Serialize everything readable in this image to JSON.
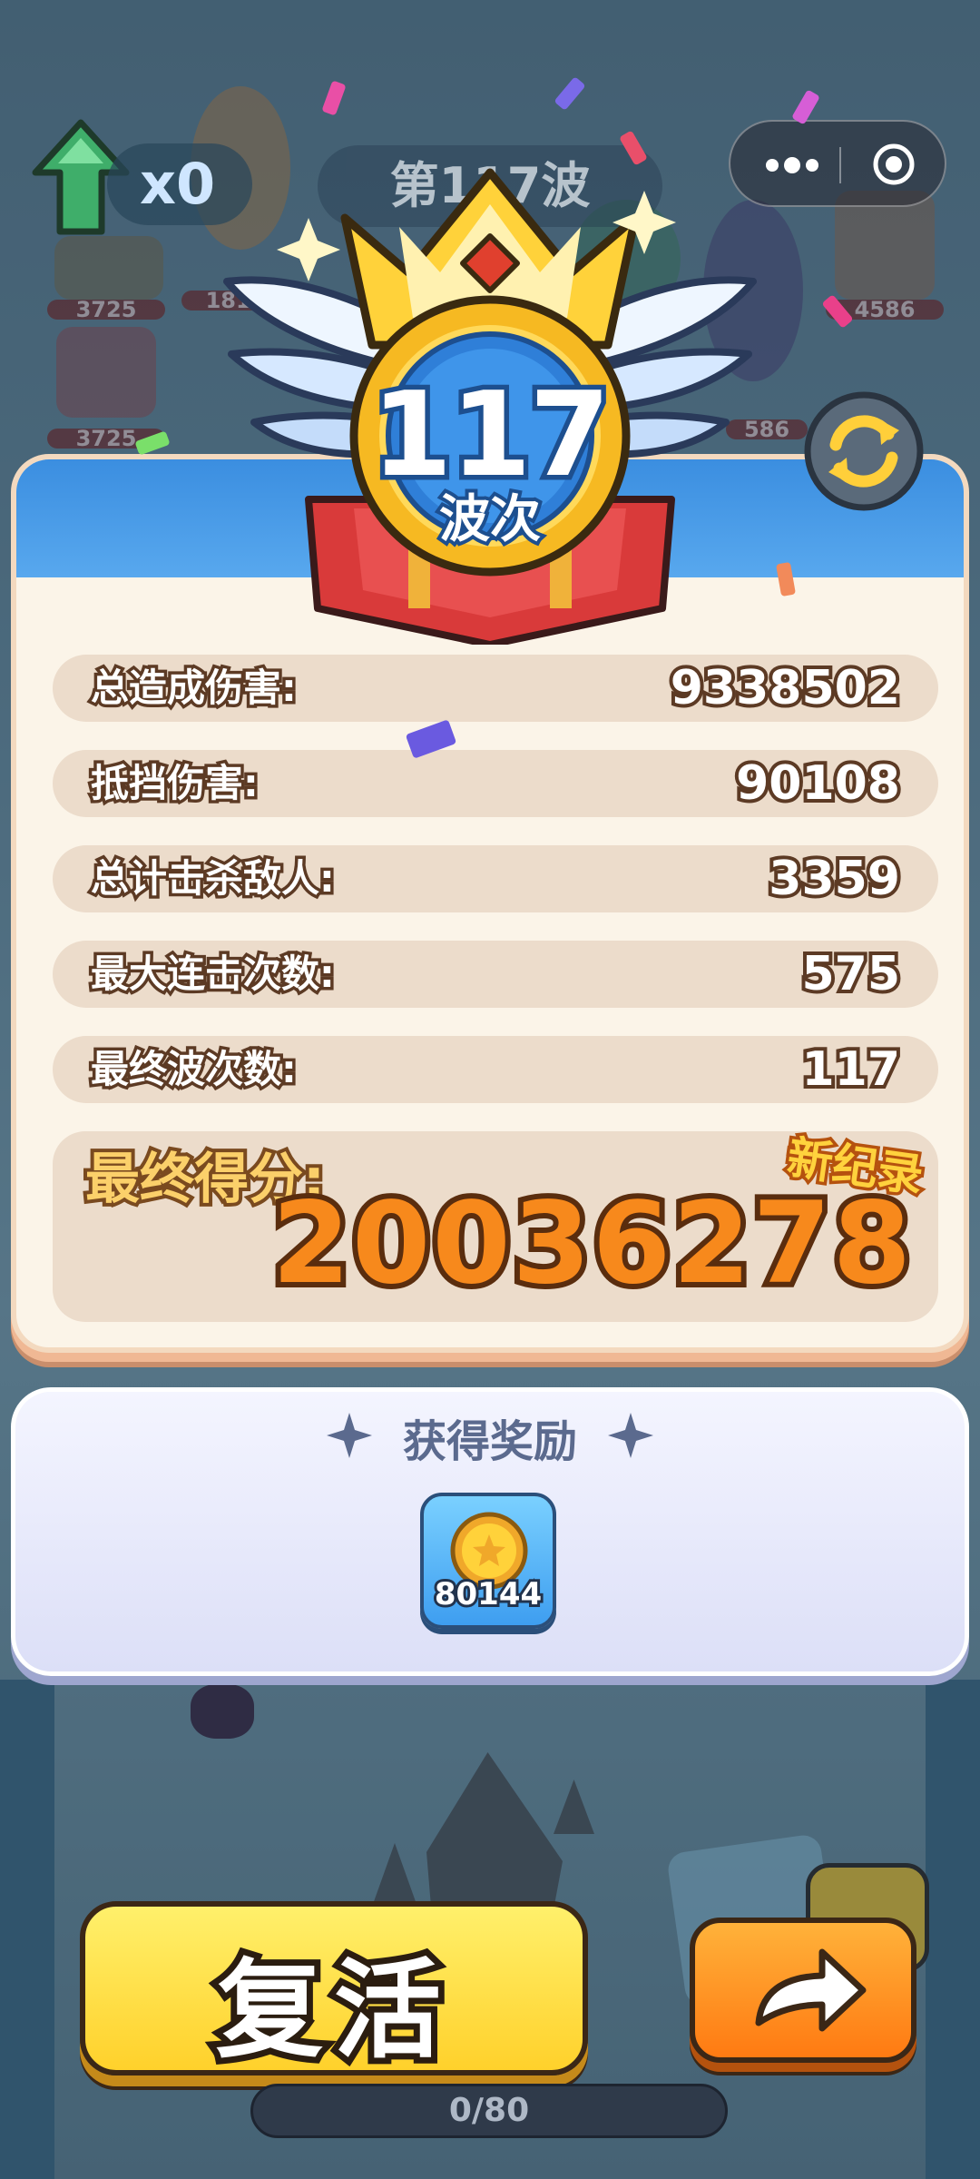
{
  "top_bar": {
    "boost_count": "x0",
    "wave_banner": "第117波"
  },
  "background": {
    "hp_values": [
      "3725",
      "1815",
      "4586",
      "3725",
      "586"
    ]
  },
  "result": {
    "wave_number": "117",
    "wave_unit": "波次",
    "stats": [
      {
        "label": "总造成伤害:",
        "value": "9338502"
      },
      {
        "label": "抵挡伤害:",
        "value": "90108"
      },
      {
        "label": "总计击杀敌人:",
        "value": "3359"
      },
      {
        "label": "最大连击次数:",
        "value": "575"
      },
      {
        "label": "最终波次数:",
        "value": "117"
      }
    ],
    "final_score_label": "最终得分:",
    "final_score": "20036278",
    "new_record_badge": "新纪录"
  },
  "reward": {
    "title": "获得奖励",
    "coin_amount": "80144"
  },
  "buttons": {
    "revive_label": "复活"
  },
  "progress": {
    "text": "0/80",
    "fraction": 0
  },
  "colors": {
    "card_band": "#3b8ee0",
    "revive_button": "#ffd12b",
    "next_button": "#ff7a12",
    "score_text": "#f7891c"
  }
}
